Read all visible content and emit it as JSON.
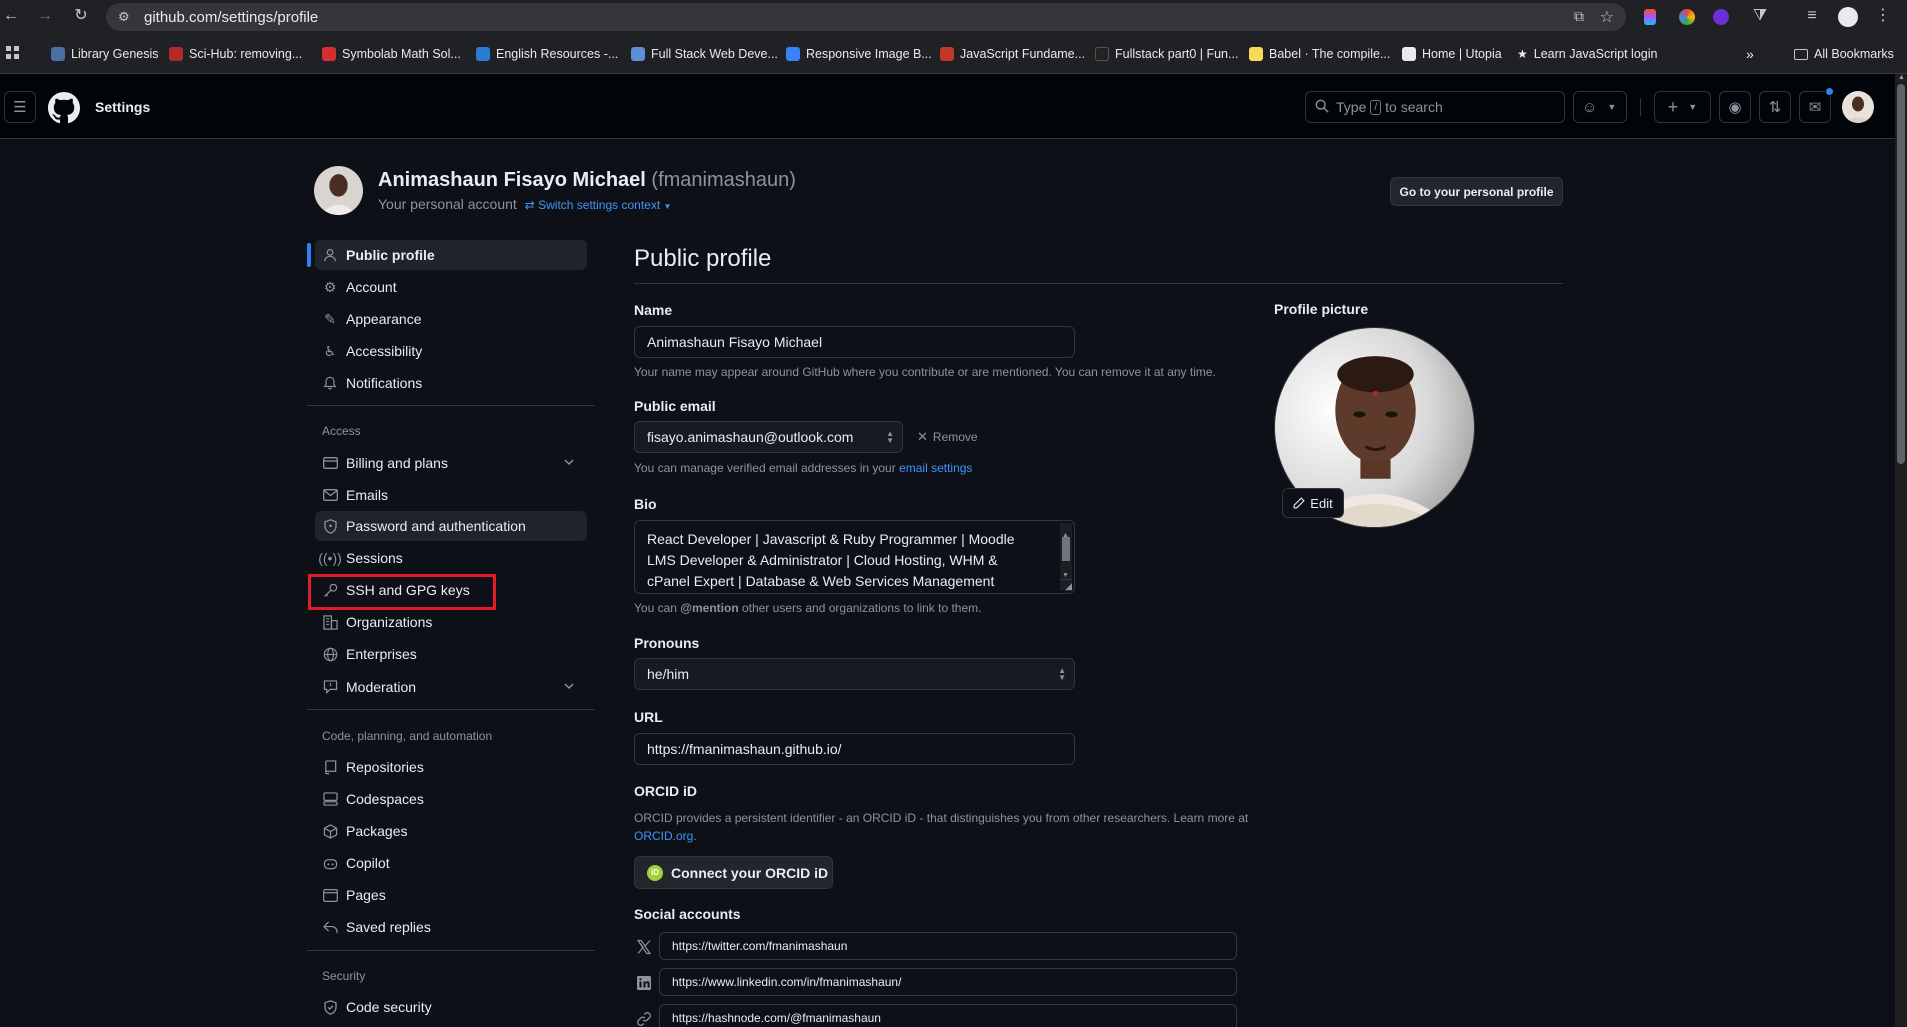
{
  "browser": {
    "url": "github.com/settings/profile",
    "bookmarks": [
      {
        "label": "Library Genesis",
        "color": "#4a6fa5"
      },
      {
        "label": "Sci-Hub: removing...",
        "color": "#b02a2a"
      },
      {
        "label": "Symbolab Math Sol...",
        "color": "#d62e2e"
      },
      {
        "label": "English Resources -...",
        "color": "#2a7bd6"
      },
      {
        "label": "Full Stack Web Deve...",
        "color": "#5b8fd6"
      },
      {
        "label": "Responsive Image B...",
        "color": "#3b82f6"
      },
      {
        "label": "JavaScript Fundame...",
        "color": "#c0392b"
      },
      {
        "label": "Fullstack part0 | Fun...",
        "color": "#222222"
      },
      {
        "label": "Babel · The compile...",
        "color": "#f5da55"
      },
      {
        "label": "Home | Utopia",
        "color": "#e8eaed"
      },
      {
        "label": "Learn JavaScript login",
        "color": "#e8eaed"
      }
    ],
    "all_bookmarks": "All Bookmarks"
  },
  "header": {
    "title": "Settings",
    "search_placeholder_pre": "Type",
    "search_key": "/",
    "search_placeholder_post": "to search"
  },
  "account": {
    "name": "Animashaun Fisayo Michael",
    "login": "(fmanimashaun)",
    "subtitle": "Your personal account",
    "switch_context": "Switch settings context",
    "go_profile": "Go to your personal profile"
  },
  "sidebar": {
    "items": [
      {
        "label": "Public profile"
      },
      {
        "label": "Account"
      },
      {
        "label": "Appearance"
      },
      {
        "label": "Accessibility"
      },
      {
        "label": "Notifications"
      }
    ],
    "access_heading": "Access",
    "access_items": [
      {
        "label": "Billing and plans"
      },
      {
        "label": "Emails"
      },
      {
        "label": "Password and authentication"
      },
      {
        "label": "Sessions"
      },
      {
        "label": "SSH and GPG keys"
      },
      {
        "label": "Organizations"
      },
      {
        "label": "Enterprises"
      },
      {
        "label": "Moderation"
      }
    ],
    "code_heading": "Code, planning, and automation",
    "code_items": [
      {
        "label": "Repositories"
      },
      {
        "label": "Codespaces"
      },
      {
        "label": "Packages"
      },
      {
        "label": "Copilot"
      },
      {
        "label": "Pages"
      },
      {
        "label": "Saved replies"
      }
    ],
    "security_heading": "Security",
    "security_items": [
      {
        "label": "Code security"
      }
    ]
  },
  "main": {
    "title": "Public profile",
    "name_label": "Name",
    "name_value": "Animashaun Fisayo Michael",
    "name_hint": "Your name may appear around GitHub where you contribute or are mentioned. You can remove it at any time.",
    "email_label": "Public email",
    "email_value": "fisayo.animashaun@outlook.com",
    "remove_label": "Remove",
    "email_hint_pre": "You can manage verified email addresses in your",
    "email_hint_link": "email settings",
    "bio_label": "Bio",
    "bio_value": "React Developer | Javascript & Ruby Programmer | Moodle LMS Developer & Administrator | Cloud Hosting, WHM & cPanel Expert | Database & Web Services Management",
    "bio_hint_pre": "You can",
    "bio_hint_mention": "@mention",
    "bio_hint_post": "other users and organizations to link to them.",
    "pronouns_label": "Pronouns",
    "pronouns_value": "he/him",
    "url_label": "URL",
    "url_value": "https://fmanimashaun.github.io/",
    "orcid_label": "ORCID iD",
    "orcid_hint": "ORCID provides a persistent identifier - an ORCID iD - that distinguishes you from other researchers. Learn more at",
    "orcid_link": "ORCID.org",
    "orcid_button": "Connect your ORCID iD",
    "social_label": "Social accounts",
    "social": [
      {
        "icon": "x-icon",
        "value": "https://twitter.com/fmanimashaun"
      },
      {
        "icon": "linkedin-icon",
        "value": "https://www.linkedin.com/in/fmanimashaun/"
      },
      {
        "icon": "link-icon",
        "value": "https://hashnode.com/@fmanimashaun"
      }
    ],
    "picture_label": "Profile picture",
    "edit_label": "Edit"
  },
  "colors": {
    "accent": "#2f81f7",
    "link": "#4493f8",
    "highlight": "#e11d2a"
  }
}
